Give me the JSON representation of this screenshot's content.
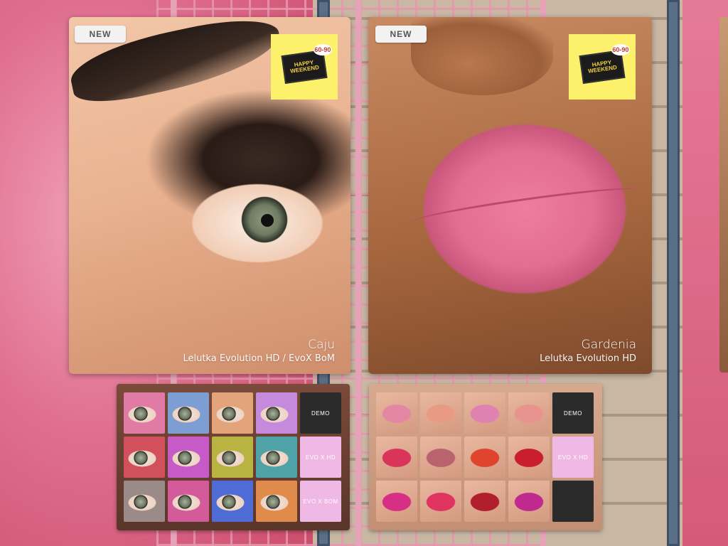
{
  "scene": {
    "eye_poster": {
      "badge": "NEW",
      "promo": {
        "line1": "HAPPY",
        "line2": "WEEKEND",
        "discount": "60-90"
      },
      "name": "Caju",
      "compat": "Lelutka Evolution HD / EvoX BoM"
    },
    "lip_poster": {
      "badge": "NEW",
      "promo": {
        "line1": "HAPPY",
        "line2": "WEEKEND",
        "discount": "60-90"
      },
      "name": "Gardenia",
      "compat": "Lelutka Evolution HD"
    },
    "eye_board": {
      "swatch_colors": [
        "#e27aa6",
        "#7d9ed3",
        "#e3a37b",
        "#c58adc",
        "#d2505c",
        "#c65ac7",
        "#b9b441",
        "#4fa3a8",
        "#9a8a88",
        "#d35b9a",
        "#4f6bd6",
        "#e08a4c"
      ],
      "buttons": {
        "demo": "DEMO",
        "evo_hd": "EVO X HD",
        "evo_bom": "EVO X BOM"
      }
    },
    "lip_board": {
      "swatch_colors": [
        "#e487a4",
        "#e99a84",
        "#df82b2",
        "#e9938f",
        "#d9345a",
        "#b9636f",
        "#e0442f",
        "#c81e2e",
        "#d62f85",
        "#df3360",
        "#b11f2c",
        "#c02a8e"
      ],
      "buttons": {
        "demo": "DEMO",
        "evo_hd": "EVO X HD"
      }
    }
  }
}
